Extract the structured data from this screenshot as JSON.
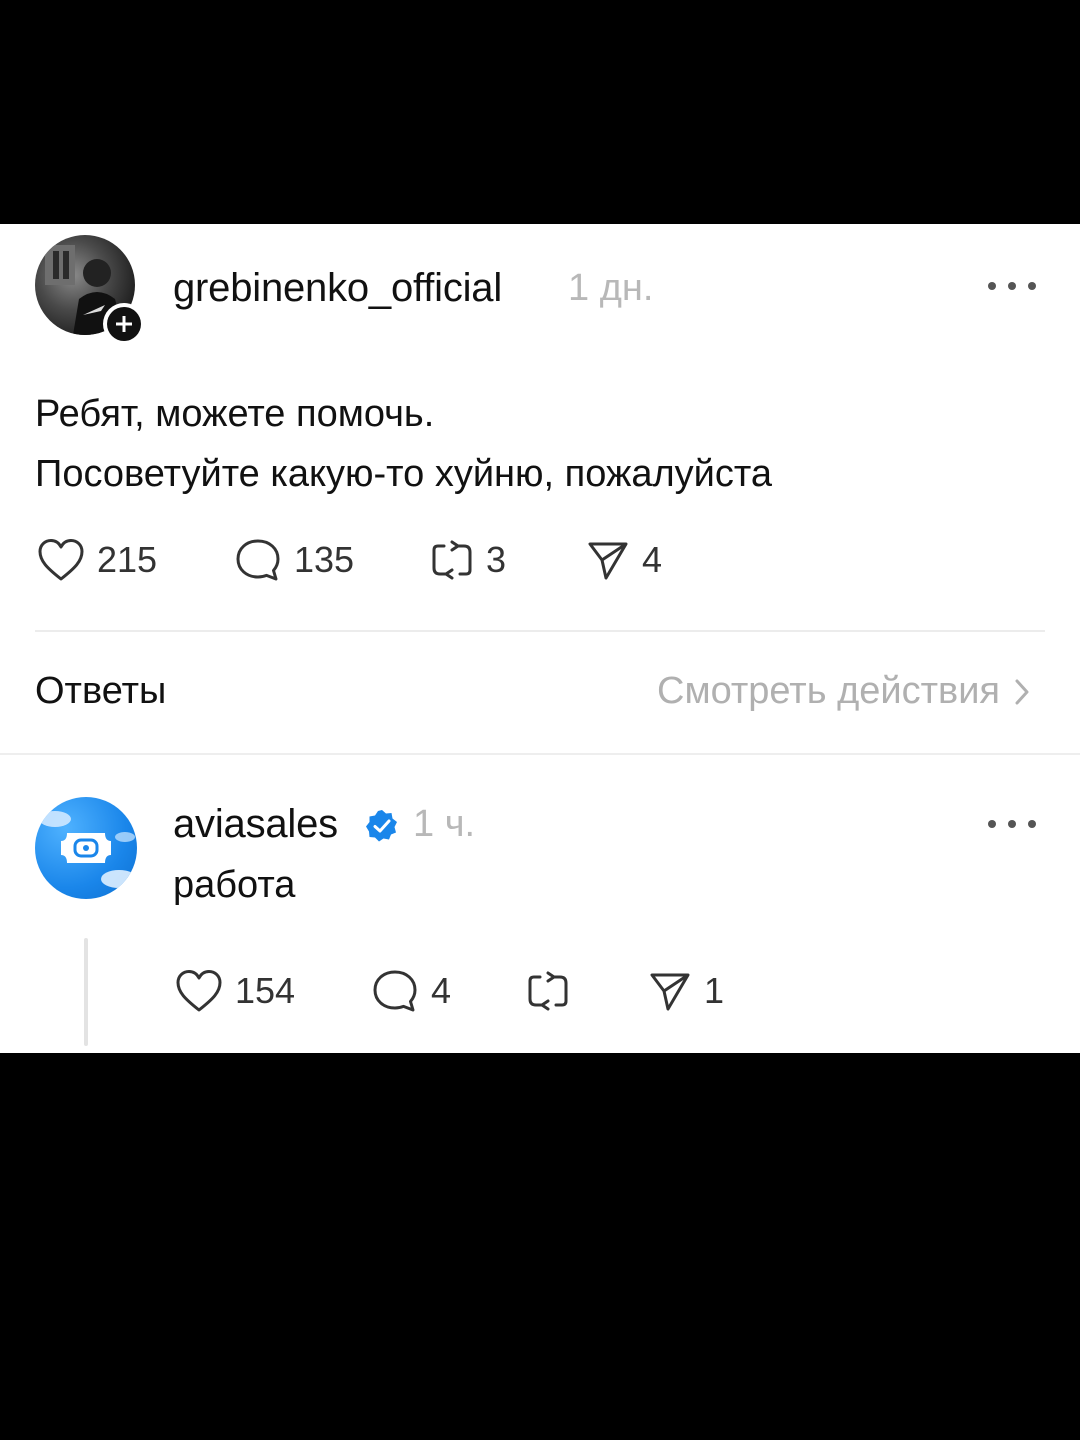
{
  "post": {
    "author": "grebinenko_official",
    "time": "1 дн.",
    "lines": [
      "Ребят, можете помочь.",
      "Посоветуйте какую-то хуйню, пожалуйста"
    ],
    "stats": {
      "likes": "215",
      "comments": "135",
      "reposts": "3",
      "shares": "4"
    }
  },
  "replies_section": {
    "title": "Ответы",
    "view_actions": "Смотреть действия"
  },
  "reply": {
    "author": "aviasales",
    "time": "1 ч.",
    "text": "работа",
    "stats": {
      "likes": "154",
      "comments": "4",
      "reposts": "",
      "shares": "1"
    }
  },
  "colors": {
    "accent_blue": "#1a86ea",
    "muted_text": "#b0b0b0"
  }
}
